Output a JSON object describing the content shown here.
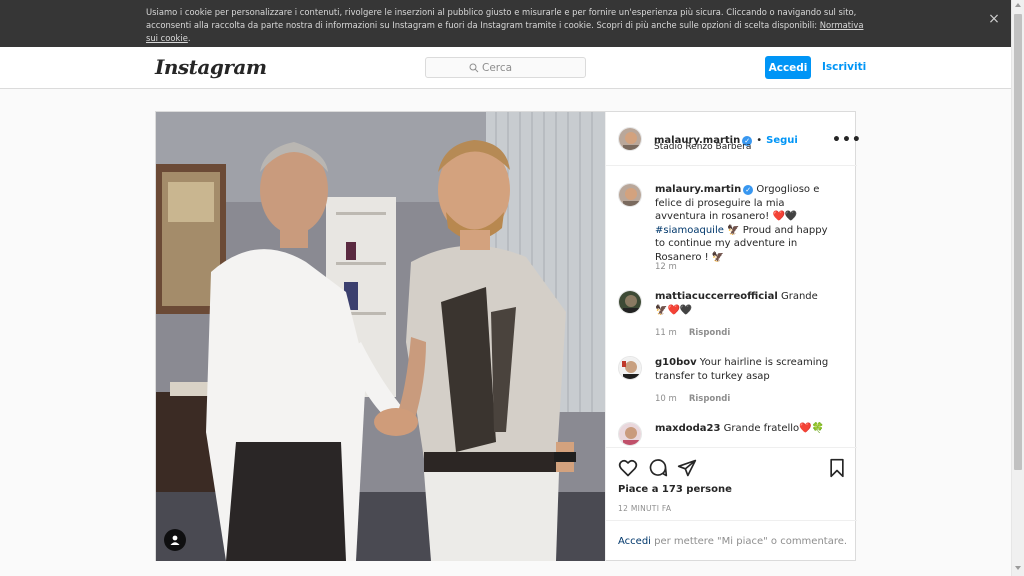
{
  "cookie_banner": {
    "text": "Usiamo i cookie per personalizzare i contenuti, rivolgere le inserzioni al pubblico giusto e misurarle e per fornire un'esperienza più sicura. Cliccando o navigando sul sito, acconsenti alla raccolta da parte nostra di informazioni su Instagram e fuori da Instagram tramite i cookie. Scopri di più anche sulle opzioni di scelta disponibili: ",
    "link": "Normativa sui cookie",
    "after_link": ".",
    "close": "×"
  },
  "header": {
    "logo": "Instagram",
    "search_placeholder": "Cerca",
    "login": "Accedi",
    "signup": "Iscriviti"
  },
  "post": {
    "author": "malaury.martin",
    "follow": "Segui",
    "separator": "•",
    "location": "Stadio Renzo Barbera",
    "more": "•••",
    "caption": {
      "user": "malaury.martin",
      "text_1": " Orgoglioso e felice di proseguire la mia avventura in rosanero! ",
      "emoji_1": "❤️🖤",
      "hashtag": "#siamoaquile",
      "emoji_2": "🦅",
      "text_2": " Proud and happy to continue my adventure in Rosanero ! ",
      "emoji_3": "🦅",
      "time": "12 m"
    },
    "comments": [
      {
        "user": "mattiacuccerreofficial",
        "text": " Grande ",
        "emoji": "🦅❤️🖤",
        "time": "11 m",
        "reply": "Rispondi"
      },
      {
        "user": "g10bov",
        "text": " Your hairline is screaming transfer to turkey asap",
        "emoji": "",
        "time": "10 m",
        "reply": "Rispondi"
      },
      {
        "user": "maxdoda23",
        "text": " Grande fratello",
        "emoji": "❤️🍀",
        "time": "",
        "reply": ""
      }
    ],
    "likes": "Piace a 173 persone",
    "timestamp": "12 MINUTI FA",
    "login_link": "Accedi",
    "login_suffix": " per mettere \"Mi piace\" o commentare."
  },
  "colors": {
    "accent": "#0095f6",
    "verified": "#3897f0",
    "cookie_bg": "#363636"
  },
  "icons": [
    "close-icon",
    "search-icon",
    "verified-icon",
    "more-icon",
    "heart-icon",
    "comment-icon",
    "share-icon",
    "bookmark-icon",
    "user-tag-icon"
  ]
}
